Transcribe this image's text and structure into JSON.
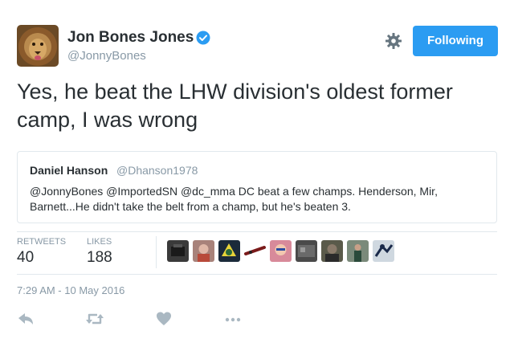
{
  "author": {
    "name": "Jon Bones Jones",
    "handle": "@JonnyBones",
    "verified": true,
    "avatar_icon": "lion-avatar"
  },
  "follow_button": {
    "label": "Following",
    "color": "#2b9cf2"
  },
  "settings_icon": "gear-icon",
  "tweet": {
    "text": "Yes, he beat the LHW division's oldest former camp, I was wrong"
  },
  "quote": {
    "name": "Daniel Hanson",
    "handle": "@Dhanson1978",
    "text": "@JonnyBones @ImportedSN @dc_mma DC beat a few champs. Henderson, Mir, Barnett...He didn't take the belt from a champ, but he's beaten 3."
  },
  "stats": {
    "retweets_label": "RETWEETS",
    "retweets_count": "40",
    "likes_label": "LIKES",
    "likes_count": "188"
  },
  "likers": [
    "liker-avatar-1",
    "liker-avatar-2",
    "liker-avatar-3",
    "liker-avatar-4",
    "liker-avatar-5",
    "liker-avatar-6",
    "liker-avatar-7",
    "liker-avatar-8",
    "liker-avatar-9"
  ],
  "timestamp": "7:29 AM - 10 May 2016",
  "actions": [
    "reply-icon",
    "retweet-icon",
    "like-icon",
    "more-icon"
  ],
  "colors": {
    "accent": "#2b9cf2",
    "muted": "#8899a6",
    "text": "#292f33",
    "border": "#e1e8ed"
  }
}
